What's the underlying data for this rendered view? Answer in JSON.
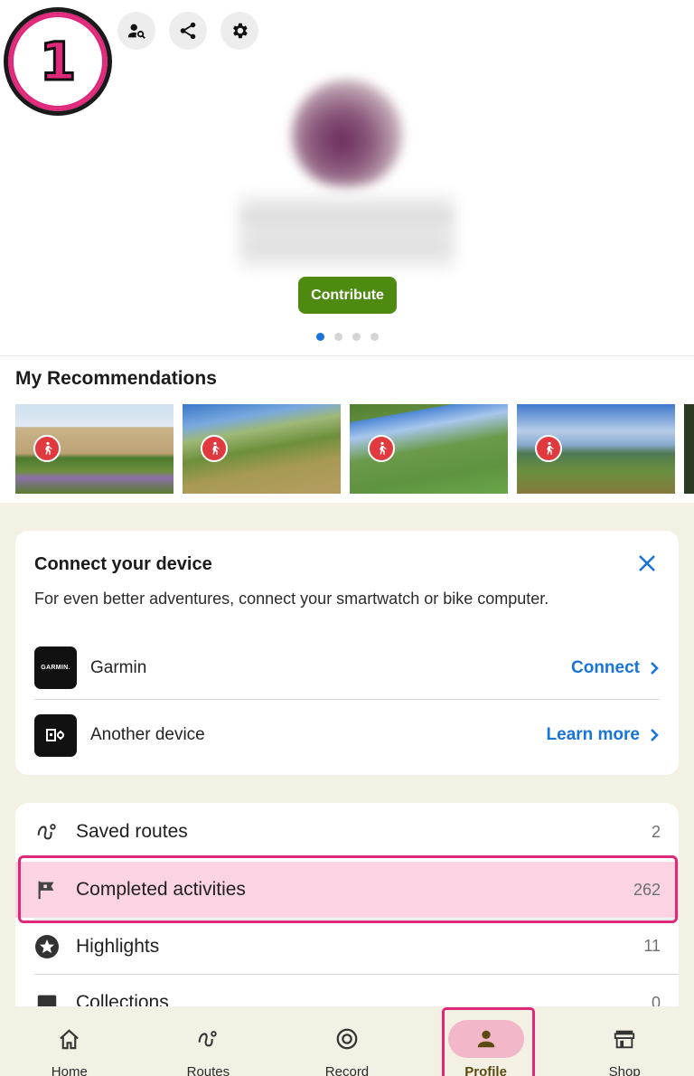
{
  "step_badge": "1",
  "profile": {
    "contribute_label": "Contribute",
    "carousel_pages": 4,
    "carousel_active": 0
  },
  "recommendations": {
    "title": "My Recommendations",
    "cards": [
      {
        "sport_icon": "hiking-icon"
      },
      {
        "sport_icon": "hiking-icon"
      },
      {
        "sport_icon": "hiking-icon"
      },
      {
        "sport_icon": "hiking-icon"
      }
    ]
  },
  "connect_device": {
    "title": "Connect your device",
    "description": "For even better adventures, connect your smartwatch or bike computer.",
    "devices": [
      {
        "logo_text": "GARMIN.",
        "name": "Garmin",
        "action": "Connect"
      },
      {
        "logo_text": "",
        "name": "Another device",
        "action": "Learn more"
      }
    ]
  },
  "profile_list": [
    {
      "label": "Saved routes",
      "count": "2",
      "icon": "route-icon"
    },
    {
      "label": "Completed activities",
      "count": "262",
      "icon": "flag-icon"
    },
    {
      "label": "Highlights",
      "count": "11",
      "icon": "star-icon"
    },
    {
      "label": "Collections",
      "count": "0",
      "icon": "collections-icon"
    }
  ],
  "bottom_nav": [
    {
      "label": "Home",
      "icon": "home-icon"
    },
    {
      "label": "Routes",
      "icon": "route-icon"
    },
    {
      "label": "Record",
      "icon": "record-icon"
    },
    {
      "label": "Profile",
      "icon": "profile-icon",
      "active": true
    },
    {
      "label": "Shop",
      "icon": "shop-icon"
    }
  ],
  "colors": {
    "accent_blue": "#1874d8",
    "contribute_green": "#4f8a10",
    "highlight_pink": "#e0287a",
    "beige_bg": "#f3f1e4"
  }
}
